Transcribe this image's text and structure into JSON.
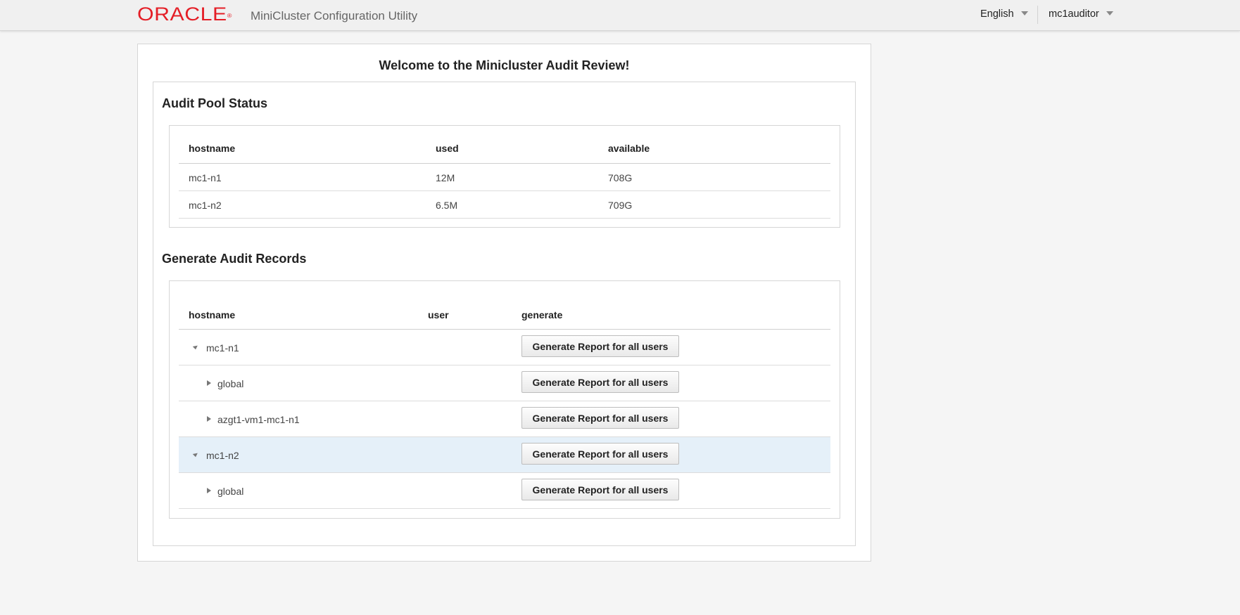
{
  "header": {
    "logo_text": "ORACLE",
    "logo_mark": "®",
    "app_title": "MiniCluster Configuration Utility",
    "language": "English",
    "user": "mc1auditor"
  },
  "colors": {
    "brand": "#e41e26",
    "selected_row": "#e5f0f9"
  },
  "page": {
    "welcome": "Welcome to the Minicluster Audit Review!"
  },
  "audit_pool": {
    "title": "Audit Pool Status",
    "columns": [
      "hostname",
      "used",
      "available"
    ],
    "rows": [
      {
        "hostname": "mc1-n1",
        "used": "12M",
        "available": "708G"
      },
      {
        "hostname": "mc1-n2",
        "used": "6.5M",
        "available": "709G"
      }
    ]
  },
  "generate": {
    "title": "Generate Audit Records",
    "columns": [
      "hostname",
      "user",
      "generate"
    ],
    "rows": [
      {
        "name": "mc1-n1",
        "level": 0,
        "state": "expanded",
        "selected": false,
        "button": "Generate Report for all users"
      },
      {
        "name": "global",
        "level": 1,
        "state": "collapsed",
        "selected": false,
        "button": "Generate Report for all users"
      },
      {
        "name": "azgt1-vm1-mc1-n1",
        "level": 1,
        "state": "collapsed",
        "selected": false,
        "button": "Generate Report for all users"
      },
      {
        "name": "mc1-n2",
        "level": 0,
        "state": "expanded",
        "selected": true,
        "button": "Generate Report for all users"
      },
      {
        "name": "global",
        "level": 1,
        "state": "collapsed",
        "selected": false,
        "button": "Generate Report for all users"
      }
    ]
  }
}
